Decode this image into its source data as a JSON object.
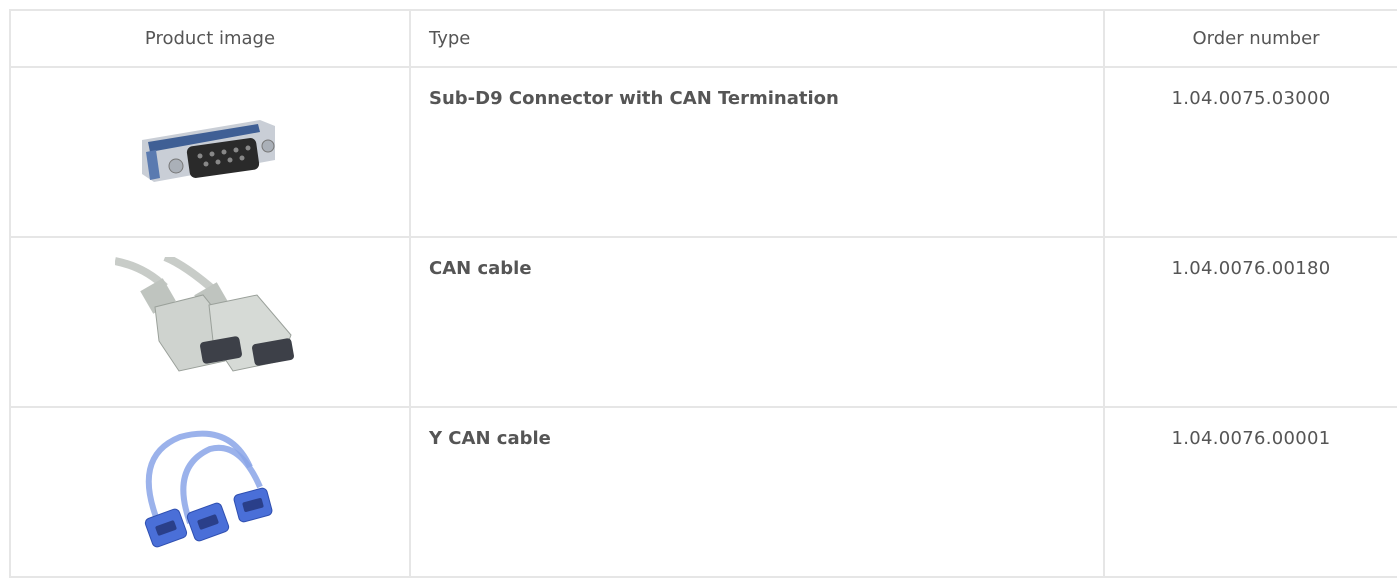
{
  "headers": {
    "image": "Product image",
    "type": "Type",
    "order": "Order number"
  },
  "rows": [
    {
      "type": "Sub-D9 Connector with CAN Termination",
      "order": "1.04.0075.03000",
      "image_icon": "sub-d9-connector-icon"
    },
    {
      "type": "CAN cable",
      "order": "1.04.0076.00180",
      "image_icon": "can-cable-icon"
    },
    {
      "type": "Y CAN cable",
      "order": "1.04.0076.00001",
      "image_icon": "y-can-cable-icon"
    }
  ]
}
